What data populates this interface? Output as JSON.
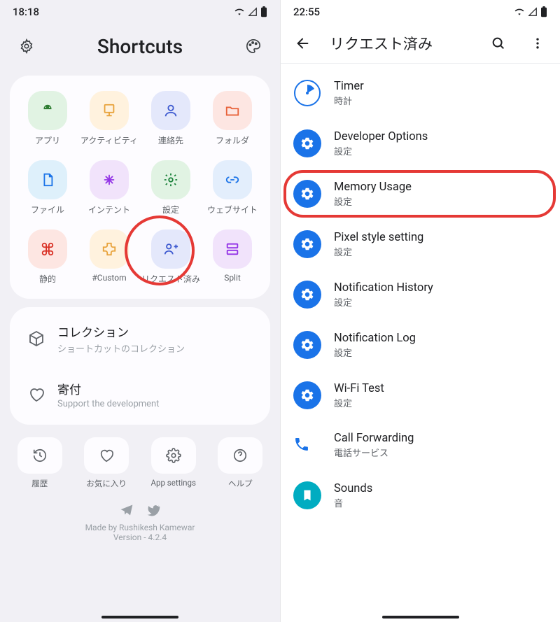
{
  "left": {
    "status_time": "18:18",
    "header_title": "Shortcuts",
    "tiles": [
      {
        "label": "アプリ",
        "bg": "#e1f3e3",
        "fg": "#2e7d32",
        "icon": "android"
      },
      {
        "label": "アクティビティ",
        "bg": "#fff2de",
        "fg": "#e8a23a",
        "icon": "activity"
      },
      {
        "label": "連絡先",
        "bg": "#e4e8fb",
        "fg": "#3f5bd0",
        "icon": "contact"
      },
      {
        "label": "フォルダ",
        "bg": "#fde6e2",
        "fg": "#e8623a",
        "icon": "folder"
      },
      {
        "label": "ファイル",
        "bg": "#def0fb",
        "fg": "#1a73e8",
        "icon": "file"
      },
      {
        "label": "インテント",
        "bg": "#f1e3fb",
        "fg": "#9334e6",
        "icon": "intent"
      },
      {
        "label": "設定",
        "bg": "#e1f3e3",
        "fg": "#188038",
        "icon": "gear"
      },
      {
        "label": "ウェブサイト",
        "bg": "#e3eefc",
        "fg": "#1a73e8",
        "icon": "link"
      },
      {
        "label": "静的",
        "bg": "#fde6e2",
        "fg": "#d93025",
        "icon": "cmd"
      },
      {
        "label": "#Custom",
        "bg": "#fff2de",
        "fg": "#e8a23a",
        "icon": "ext"
      },
      {
        "label": "リクエスト済み",
        "bg": "#e4e8fb",
        "fg": "#3f5bd0",
        "icon": "req",
        "hl": true
      },
      {
        "label": "Split",
        "bg": "#f1e3fb",
        "fg": "#9334e6",
        "icon": "split"
      }
    ],
    "list": [
      {
        "title": "コレクション",
        "sub": "ショートカットのコレクション",
        "icon": "cube"
      },
      {
        "title": "寄付",
        "sub": "Support the development",
        "icon": "heart"
      }
    ],
    "bottom": [
      {
        "label": "履歴",
        "icon": "history"
      },
      {
        "label": "お気に入り",
        "icon": "heart"
      },
      {
        "label": "App settings",
        "icon": "gear2"
      },
      {
        "label": "ヘルプ",
        "icon": "help"
      }
    ],
    "footer_credit": "Made by Rushikesh Kamewar",
    "footer_version": "Version - 4.2.4"
  },
  "right": {
    "status_time": "22:55",
    "header_title": "リクエスト済み",
    "items": [
      {
        "title": "Timer",
        "sub": "時計",
        "icon": "clock"
      },
      {
        "title": "Developer Options",
        "sub": "設定",
        "icon": "gear"
      },
      {
        "title": "Memory Usage",
        "sub": "設定",
        "icon": "gear",
        "hl": true
      },
      {
        "title": "Pixel style setting",
        "sub": "設定",
        "icon": "gear"
      },
      {
        "title": "Notification History",
        "sub": "設定",
        "icon": "gear"
      },
      {
        "title": "Notification Log",
        "sub": "設定",
        "icon": "gear"
      },
      {
        "title": "Wi-Fi Test",
        "sub": "設定",
        "icon": "gear"
      },
      {
        "title": "Call Forwarding",
        "sub": "電話サービス",
        "icon": "phone"
      },
      {
        "title": "Sounds",
        "sub": "音",
        "icon": "sounds"
      }
    ]
  }
}
